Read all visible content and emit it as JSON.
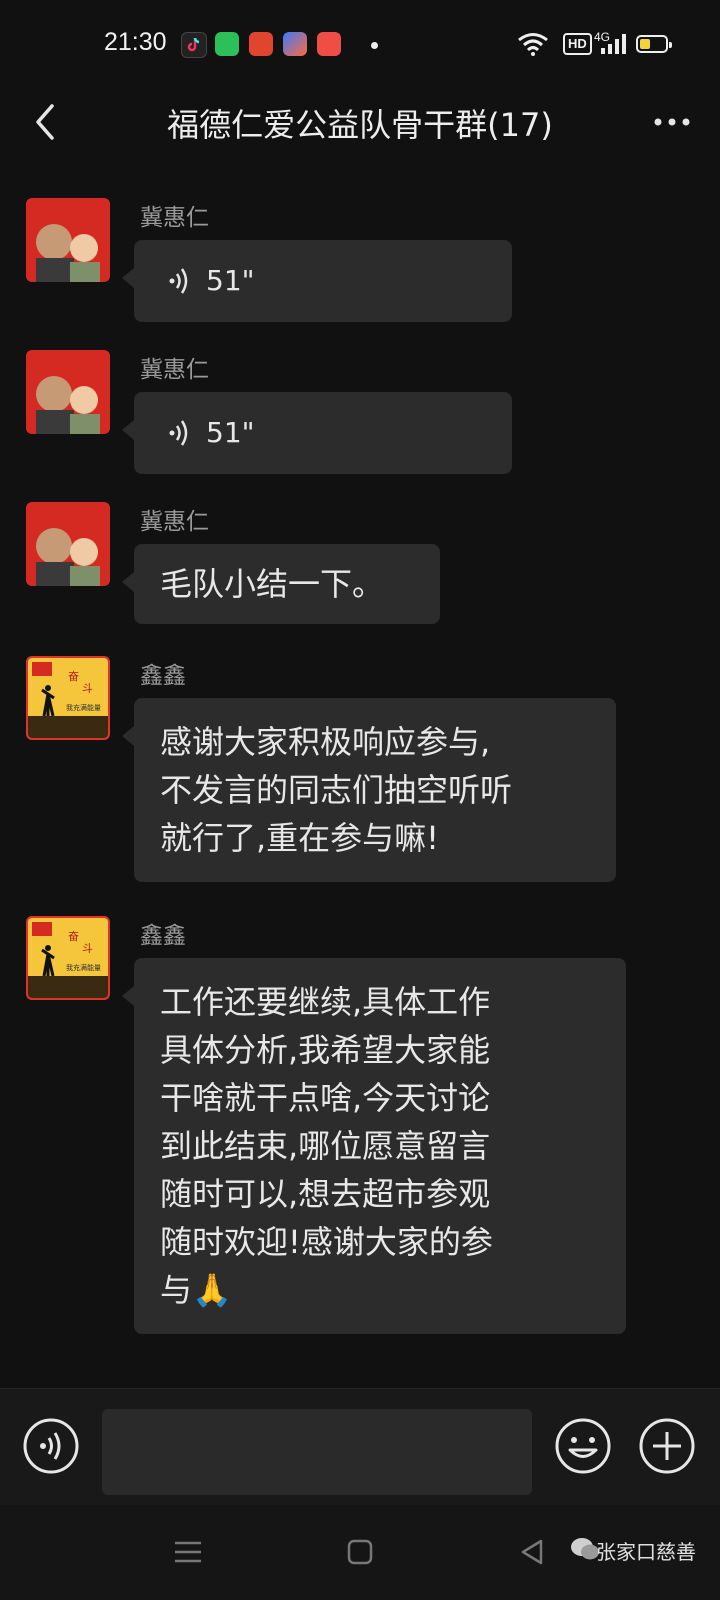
{
  "status_bar": {
    "time": "21:30",
    "network": "4G",
    "hd_label": "HD",
    "battery_level": 0.4,
    "app_icons": [
      "tiktok-icon",
      "green-app-icon",
      "red-app-icon",
      "colorful-app-icon",
      "music-app-icon"
    ]
  },
  "header": {
    "title": "福德仁爱公益队骨干群(17)"
  },
  "messages": [
    {
      "sender": "冀惠仁",
      "type": "voice",
      "duration": "51\""
    },
    {
      "sender": "冀惠仁",
      "type": "voice",
      "duration": "51\""
    },
    {
      "sender": "冀惠仁",
      "type": "text",
      "lines": [
        "毛队小结一下。"
      ]
    },
    {
      "sender": "鑫鑫",
      "type": "text",
      "lines": [
        "感谢大家积极响应参与,",
        "不发言的同志们抽空听听",
        "就行了,重在参与嘛!"
      ]
    },
    {
      "sender": "鑫鑫",
      "type": "text",
      "lines": [
        "工作还要继续,具体工作",
        "具体分析,我希望大家能",
        "干啥就干点啥,今天讨论",
        "到此结束,哪位愿意留言",
        "随时可以,想去超市参观",
        "随时欢迎!感谢大家的参",
        "与🙏"
      ]
    }
  ],
  "avatars": {
    "xinxin_text_line1": "奋",
    "xinxin_text_line2": "斗",
    "xinxin_text_line3": "我充满能量"
  },
  "watermark": "张家口慈善"
}
